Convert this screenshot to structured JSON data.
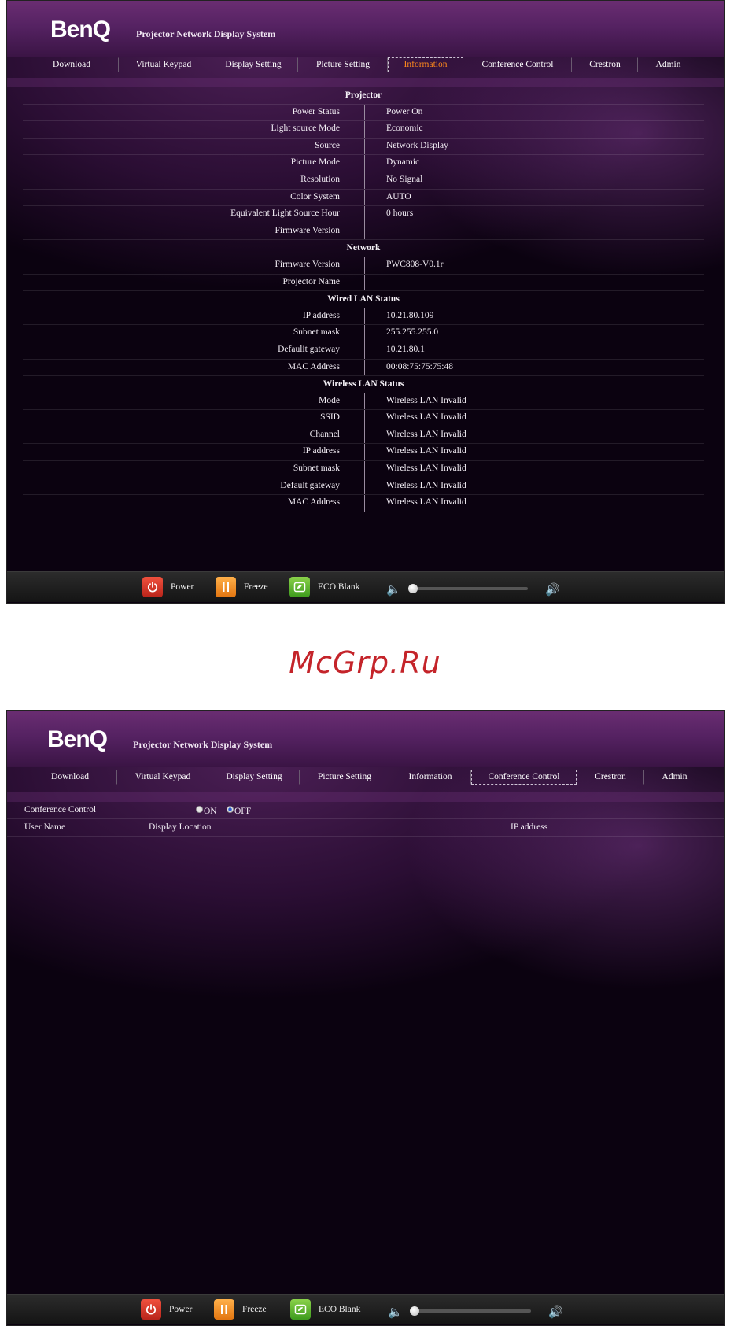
{
  "header": {
    "logo": "BenQ",
    "system_title": "Projector Network Display System"
  },
  "tabs": [
    "Download",
    "Virtual Keypad",
    "Display Setting",
    "Picture Setting",
    "Information",
    "Conference Control",
    "Crestron",
    "Admin"
  ],
  "information": {
    "projector": {
      "title": "Projector",
      "rows": [
        {
          "label": "Power Status",
          "value": "Power On"
        },
        {
          "label": "Light source Mode",
          "value": "Economic"
        },
        {
          "label": "Source",
          "value": "Network Display"
        },
        {
          "label": "Picture Mode",
          "value": "Dynamic"
        },
        {
          "label": "Resolution",
          "value": "No Signal"
        },
        {
          "label": "Color System",
          "value": "AUTO"
        },
        {
          "label": "Equivalent Light Source Hour",
          "value": "0 hours"
        },
        {
          "label": "Firmware Version",
          "value": ""
        }
      ]
    },
    "network": {
      "title": "Network",
      "rows": [
        {
          "label": "Firmware Version",
          "value": "PWC808-V0.1r"
        },
        {
          "label": "Projector Name",
          "value": ""
        }
      ]
    },
    "wired": {
      "title": "Wired LAN Status",
      "rows": [
        {
          "label": "IP address",
          "value": "10.21.80.109"
        },
        {
          "label": "Subnet mask",
          "value": "255.255.255.0"
        },
        {
          "label": "Defaulit gateway",
          "value": "10.21.80.1"
        },
        {
          "label": "MAC Address",
          "value": "00:08:75:75:75:48"
        }
      ]
    },
    "wireless": {
      "title": "Wireless LAN Status",
      "rows": [
        {
          "label": "Mode",
          "value": "Wireless LAN Invalid"
        },
        {
          "label": "SSID",
          "value": "Wireless LAN Invalid"
        },
        {
          "label": "Channel",
          "value": "Wireless LAN Invalid"
        },
        {
          "label": "IP address",
          "value": "Wireless LAN Invalid"
        },
        {
          "label": "Subnet mask",
          "value": "Wireless LAN Invalid"
        },
        {
          "label": "Default gateway",
          "value": "Wireless LAN Invalid"
        },
        {
          "label": "MAC Address",
          "value": "Wireless LAN Invalid"
        }
      ]
    }
  },
  "conference": {
    "label": "Conference Control",
    "on_label": "ON",
    "off_label": "OFF",
    "selected": "OFF",
    "columns": [
      "User Name",
      "Display Location",
      "IP address"
    ]
  },
  "footer": {
    "power_label": "Power",
    "freeze_label": "Freeze",
    "eco_label": "ECO Blank",
    "volume_level": 0
  },
  "watermark": "McGrp.Ru"
}
